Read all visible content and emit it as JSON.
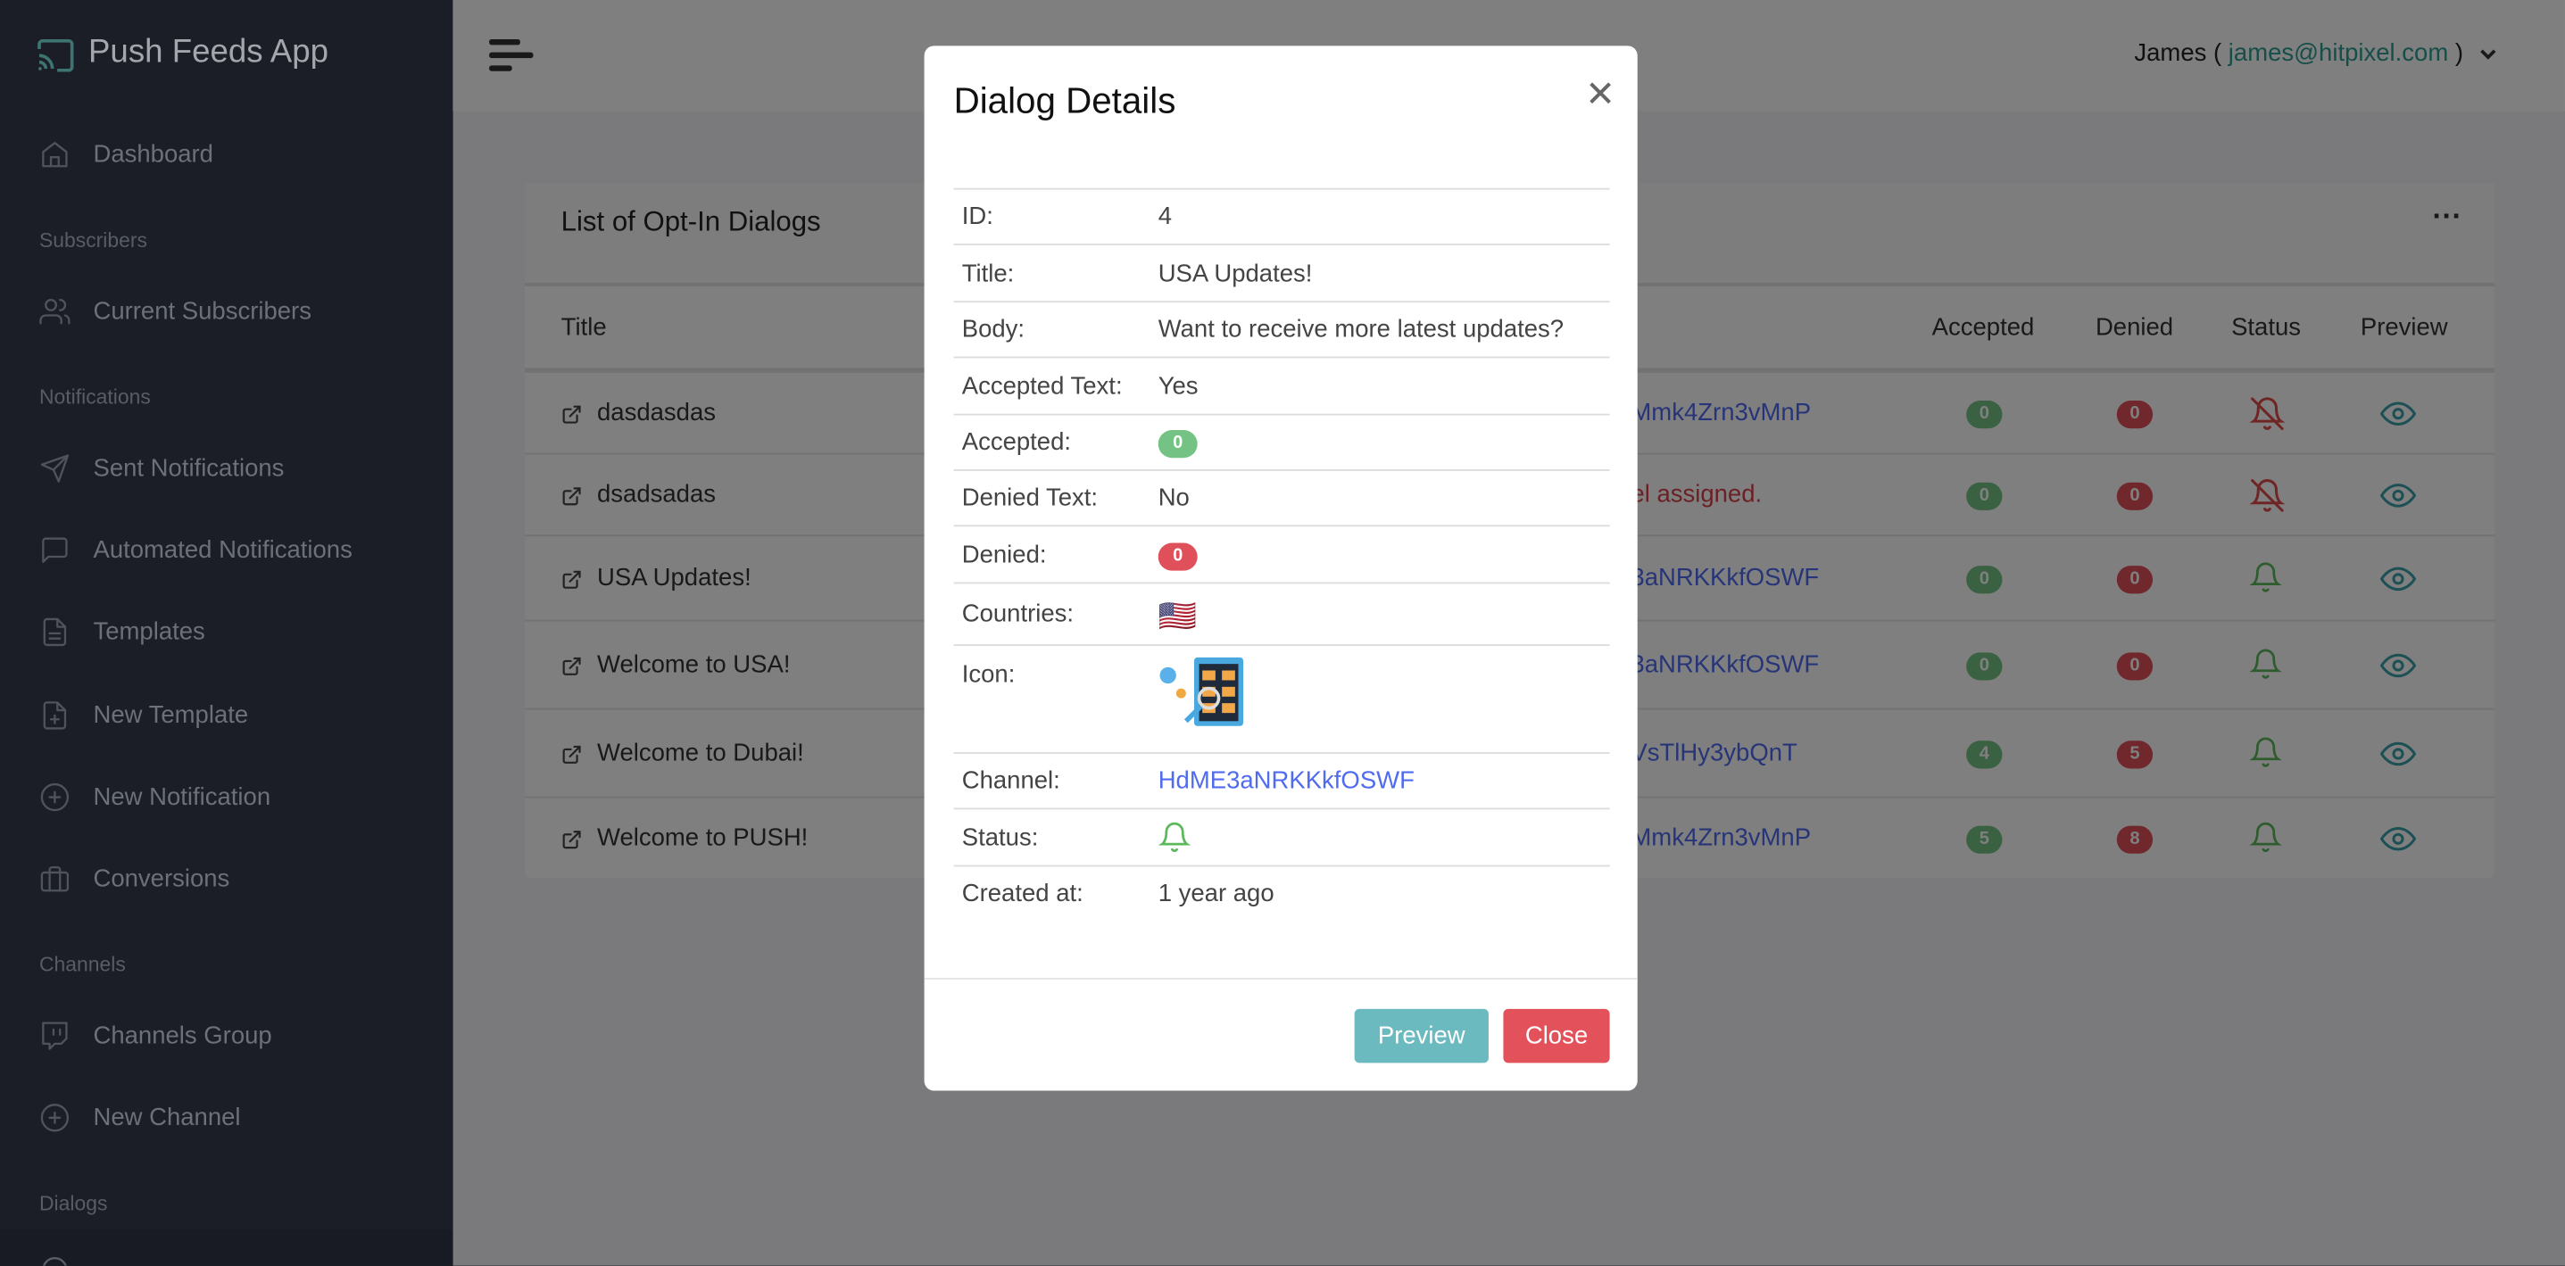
{
  "app": {
    "name": "Push Feeds App"
  },
  "colors": {
    "accent": "#2f9c92",
    "link": "#4f6bf0",
    "success": "#74c384",
    "danger": "#e0505a",
    "preview": "#6bbac0"
  },
  "sidebar": {
    "items": [
      {
        "label": "Dashboard",
        "icon": "home-icon"
      },
      {
        "header": "Subscribers"
      },
      {
        "label": "Current Subscribers",
        "icon": "users-icon"
      },
      {
        "header": "Notifications"
      },
      {
        "label": "Sent Notifications",
        "icon": "send-icon"
      },
      {
        "label": "Automated Notifications",
        "icon": "message-square-icon"
      },
      {
        "label": "Templates",
        "icon": "file-text-icon"
      },
      {
        "label": "New Template",
        "icon": "file-plus-icon"
      },
      {
        "label": "New Notification",
        "icon": "plus-circle-icon"
      },
      {
        "label": "Conversions",
        "icon": "briefcase-icon"
      },
      {
        "header": "Channels"
      },
      {
        "label": "Channels Group",
        "icon": "twitch-icon"
      },
      {
        "label": "New Channel",
        "icon": "plus-circle-icon"
      },
      {
        "header": "Dialogs"
      }
    ]
  },
  "topbar": {
    "user_name": "James (",
    "user_email": "james@hitpixel.com",
    "user_close": ")"
  },
  "card": {
    "title": "List of Opt-In Dialogs",
    "columns": {
      "title": "Title",
      "accepted": "Accepted",
      "denied": "Denied",
      "status": "Status",
      "preview": "Preview"
    },
    "rows": [
      {
        "title": "dasdasdas",
        "channel": "Mmk4Zrn3vMnP",
        "channel_error": false,
        "accepted": "0",
        "denied": "0",
        "status": "inactive"
      },
      {
        "title": "dsadsadas",
        "channel": "el assigned.",
        "channel_error": true,
        "accepted": "0",
        "denied": "0",
        "status": "inactive"
      },
      {
        "title": "USA Updates!",
        "channel": "3aNRKKkfOSWF",
        "channel_error": false,
        "accepted": "0",
        "denied": "0",
        "status": "active"
      },
      {
        "title": "Welcome to USA!",
        "channel": "3aNRKKkfOSWF",
        "channel_error": false,
        "accepted": "0",
        "denied": "0",
        "status": "active"
      },
      {
        "title": "Welcome to Dubai!",
        "channel": "VsTlHy3ybQnT",
        "channel_error": false,
        "accepted": "4",
        "denied": "5",
        "status": "active"
      },
      {
        "title": "Welcome to PUSH!",
        "channel": "Mmk4Zrn3vMnP",
        "channel_error": false,
        "accepted": "5",
        "denied": "8",
        "status": "active"
      }
    ]
  },
  "modal": {
    "title": "Dialog Details",
    "fields": {
      "id": {
        "label": "ID:",
        "value": "4"
      },
      "title": {
        "label": "Title:",
        "value": "USA Updates!"
      },
      "body": {
        "label": "Body:",
        "value": "Want to receive more latest updates?"
      },
      "accepted_text": {
        "label": "Accepted Text:",
        "value": "Yes"
      },
      "accepted": {
        "label": "Accepted:",
        "value": "0"
      },
      "denied_text": {
        "label": "Denied Text:",
        "value": "No"
      },
      "denied": {
        "label": "Denied:",
        "value": "0"
      },
      "countries": {
        "label": "Countries:",
        "value": "🇺🇸"
      },
      "icon": {
        "label": "Icon:"
      },
      "channel": {
        "label": "Channel:",
        "value": "HdME3aNRKKkfOSWF"
      },
      "status": {
        "label": "Status:",
        "value": "active"
      },
      "created_at": {
        "label": "Created at:",
        "value": "1 year ago"
      }
    },
    "preview_label": "Preview",
    "close_label": "Close"
  }
}
